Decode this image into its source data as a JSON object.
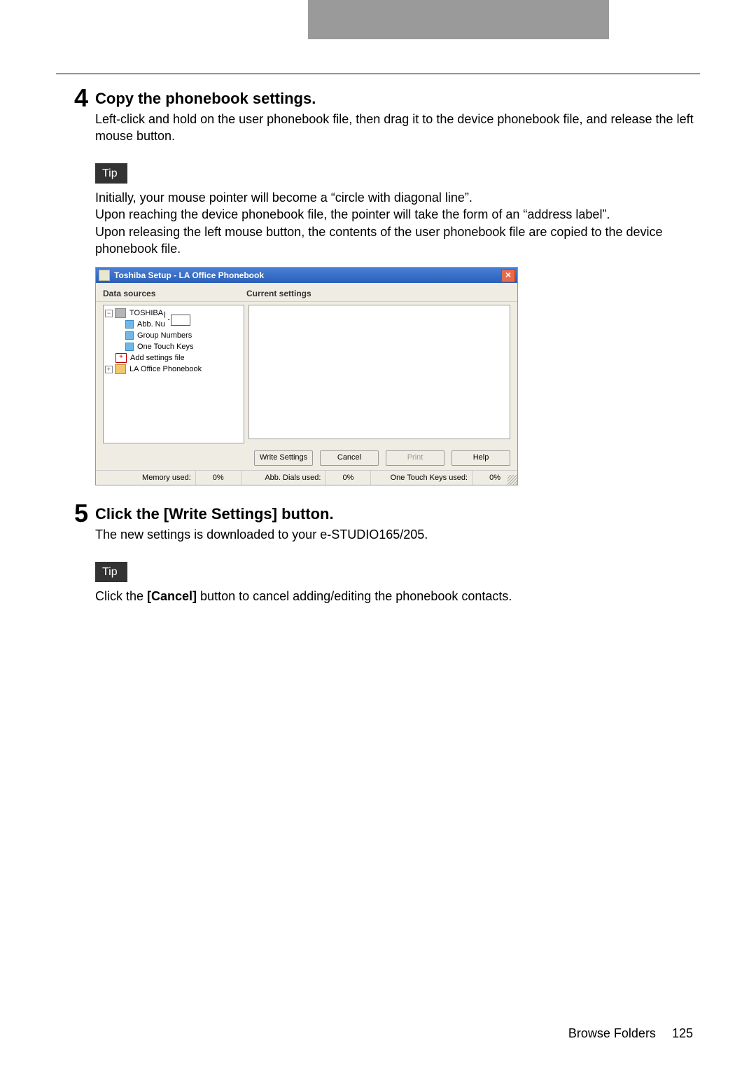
{
  "steps": {
    "s4": {
      "num": "4",
      "title": "Copy the phonebook settings.",
      "text": "Left-click and hold on the user phonebook file, then drag it to the device phonebook file, and release the left mouse button.",
      "tip_label": "Tip",
      "tip_p1": "Initially, your mouse pointer will become a “circle with diagonal line”.",
      "tip_p2": "Upon reaching the device phonebook file, the pointer will take the form of an “address label”.",
      "tip_p3": "Upon releasing the left mouse button, the contents of the user phonebook file are copied to the device phonebook file."
    },
    "s5": {
      "num": "5",
      "title": "Click the [Write Settings] button.",
      "text": "The new settings is downloaded to your e-STUDIO165/205.",
      "tip_label": "Tip",
      "tip_p1a": "Click the ",
      "tip_p1b": "[Cancel]",
      "tip_p1c": " button to cancel adding/editing the phonebook contacts."
    }
  },
  "win": {
    "title": "Toshiba Setup - LA Office Phonebook",
    "headers": {
      "left": "Data sources",
      "right": "Current settings"
    },
    "tree": {
      "root": "TOSHIBA",
      "n1": "Abb. Nu",
      "n2": "Group Numbers",
      "n3": "One Touch Keys",
      "add": "Add settings file",
      "folder": "LA Office Phonebook"
    },
    "buttons": {
      "write": "Write Settings",
      "cancel": "Cancel",
      "print": "Print",
      "help": "Help"
    },
    "status": {
      "mem_lbl": "Memory used:",
      "mem_val": "0%",
      "abb_lbl": "Abb. Dials used:",
      "abb_val": "0%",
      "otk_lbl": "One Touch Keys used:",
      "otk_val": "0%"
    }
  },
  "footer": {
    "section": "Browse Folders",
    "page": "125"
  }
}
